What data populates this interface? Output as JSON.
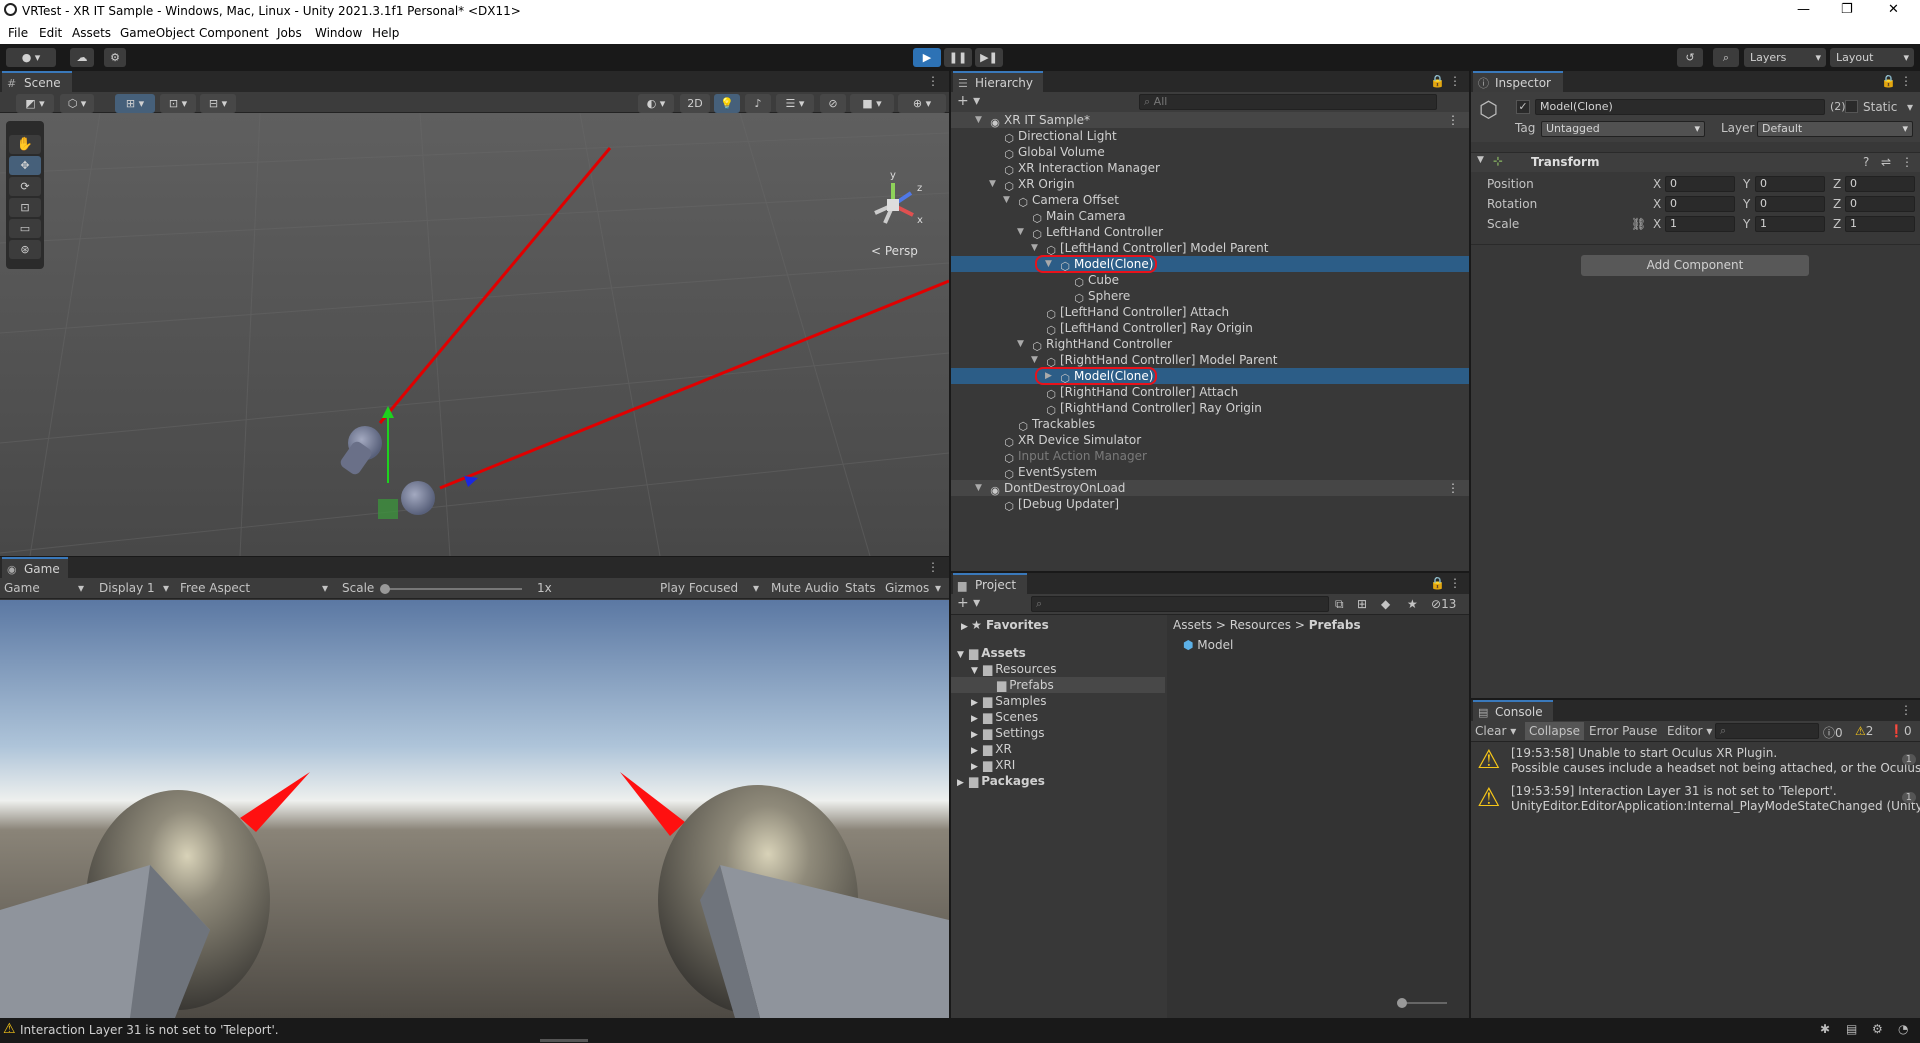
{
  "window": {
    "title": "VRTest - XR IT Sample - Windows, Mac, Linux - Unity 2021.3.1f1 Personal* <DX11>",
    "min": "—",
    "max": "❐",
    "close": "✕"
  },
  "menu": [
    "File",
    "Edit",
    "Assets",
    "GameObject",
    "Component",
    "Jobs",
    "Window",
    "Help"
  ],
  "toolbar": {
    "layers": "Layers",
    "layout": "Layout"
  },
  "scene": {
    "tab": "Scene",
    "persp": "Persp",
    "btn2d": "2D",
    "gizmo_y": "y",
    "gizmo_x": "x",
    "gizmo_z": "z"
  },
  "game": {
    "tab": "Game",
    "mode": "Game",
    "display": "Display 1",
    "aspect": "Free Aspect",
    "scale_label": "Scale",
    "scale_value": "1x",
    "play_focused": "Play Focused",
    "mute": "Mute Audio",
    "stats": "Stats",
    "gizmos": "Gizmos"
  },
  "hierarchy": {
    "tab": "Hierarchy",
    "search_placeholder": "All",
    "rows": [
      {
        "label": "XR IT Sample*",
        "depth": 0,
        "scene": true,
        "expanded": true
      },
      {
        "label": "Directional Light",
        "depth": 1
      },
      {
        "label": "Global Volume",
        "depth": 1
      },
      {
        "label": "XR Interaction Manager",
        "depth": 1
      },
      {
        "label": "XR Origin",
        "depth": 1,
        "expanded": true
      },
      {
        "label": "Camera Offset",
        "depth": 2,
        "expanded": true
      },
      {
        "label": "Main Camera",
        "depth": 3
      },
      {
        "label": "LeftHand Controller",
        "depth": 3,
        "expanded": true
      },
      {
        "label": "[LeftHand Controller] Model Parent",
        "depth": 4,
        "expanded": true
      },
      {
        "label": "Model(Clone)",
        "depth": 5,
        "expanded": true,
        "selected": true
      },
      {
        "label": "Cube",
        "depth": 6
      },
      {
        "label": "Sphere",
        "depth": 6
      },
      {
        "label": "[LeftHand Controller] Attach",
        "depth": 4
      },
      {
        "label": "[LeftHand Controller] Ray Origin",
        "depth": 4
      },
      {
        "label": "RightHand Controller",
        "depth": 3,
        "expanded": true
      },
      {
        "label": "[RightHand Controller] Model Parent",
        "depth": 4,
        "expanded": true
      },
      {
        "label": "Model(Clone)",
        "depth": 5,
        "collapsed": true,
        "selected": true
      },
      {
        "label": "[RightHand Controller] Attach",
        "depth": 4
      },
      {
        "label": "[RightHand Controller] Ray Origin",
        "depth": 4
      },
      {
        "label": "Trackables",
        "depth": 2
      },
      {
        "label": "XR Device Simulator",
        "depth": 1
      },
      {
        "label": "Input Action Manager",
        "depth": 1,
        "disabled": true
      },
      {
        "label": "EventSystem",
        "depth": 1
      },
      {
        "label": "DontDestroyOnLoad",
        "depth": 0,
        "scene": true,
        "expanded": true
      },
      {
        "label": "[Debug Updater]",
        "depth": 1
      }
    ]
  },
  "inspector": {
    "tab": "Inspector",
    "name": "Model(Clone)",
    "count": "(2)",
    "static": "Static",
    "tag_label": "Tag",
    "tag": "Untagged",
    "layer_label": "Layer",
    "layer": "Default",
    "transform": "Transform",
    "position_label": "Position",
    "rotation_label": "Rotation",
    "scale_label": "Scale",
    "position": [
      "0",
      "0",
      "0"
    ],
    "rotation": [
      "0",
      "0",
      "0"
    ],
    "scale": [
      "1",
      "1",
      "1"
    ],
    "axis": [
      "X",
      "Y",
      "Z"
    ],
    "add_component": "Add Component"
  },
  "project": {
    "tab": "Project",
    "hidden_count": "13",
    "favorites": "Favorites",
    "tree": [
      {
        "label": "Assets",
        "depth": 0,
        "bold": true,
        "expanded": true
      },
      {
        "label": "Resources",
        "depth": 1,
        "expanded": true
      },
      {
        "label": "Prefabs",
        "depth": 2,
        "selected": true
      },
      {
        "label": "Samples",
        "depth": 1
      },
      {
        "label": "Scenes",
        "depth": 1
      },
      {
        "label": "Settings",
        "depth": 1
      },
      {
        "label": "XR",
        "depth": 1
      },
      {
        "label": "XRI",
        "depth": 1
      },
      {
        "label": "Packages",
        "depth": 0,
        "bold": true
      }
    ],
    "breadcrumb": [
      "Assets",
      "Resources",
      "Prefabs"
    ],
    "asset": "Model"
  },
  "console": {
    "tab": "Console",
    "clear": "Clear",
    "collapse": "Collapse",
    "error_pause": "Error Pause",
    "editor": "Editor",
    "info_count": "0",
    "warn_count": "2",
    "error_count": "0",
    "messages": [
      {
        "line1": "[19:53:58] Unable to start Oculus XR Plugin.",
        "line2": "Possible causes include a headset not being attached, or the Oculus runti",
        "count": "1"
      },
      {
        "line1": "[19:53:59] Interaction Layer 31 is not set to 'Teleport'.",
        "line2": "UnityEditor.EditorApplication:Internal_PlayModeStateChanged (UnityEditor",
        "count": "1"
      }
    ]
  },
  "status": {
    "text": "Interaction Layer 31 is not set to 'Teleport'."
  }
}
